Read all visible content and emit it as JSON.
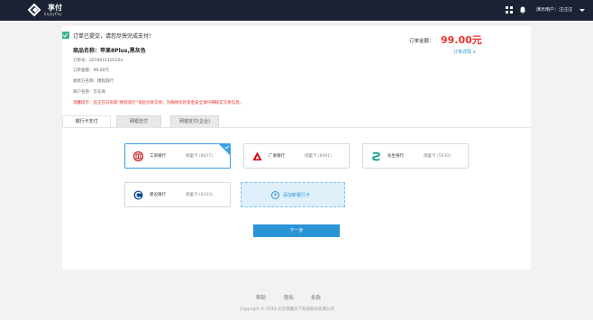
{
  "header": {
    "brand_name": "享付",
    "brand_sub": "EnjoyPay",
    "user_label": "演示用户：汪汪汪",
    "icons": [
      "grid-icon",
      "bell-icon",
      "caret-down-icon"
    ]
  },
  "order": {
    "submitted_text": "订单已提交，请您尽快完成支付！",
    "product_name": "商品名称：苹果8Plus,黑灰色",
    "order_no": "订单号：2019011105204",
    "order_amount": "订单金额：99.00元",
    "payee": "收款方名称：携程旅行",
    "merchant": "商户名称：京东商",
    "warning": "温馨提示：您正在向商家“携程旅行”发起付款交易，为确保您的资金安全请仔细核实交易信息。",
    "amount_label": "订单金额：",
    "amount_value": "99.00元",
    "detail_link": "订单详情 ∧"
  },
  "tabs": [
    {
      "label": "银行卡支付",
      "active": true
    },
    {
      "label": "网银支付",
      "active": false
    },
    {
      "label": "网银支付(企业)",
      "active": false
    }
  ],
  "cards": [
    {
      "bank": "工商银行",
      "type": "储蓄卡 (8027)",
      "icon": "icbc-icon",
      "color": "#c8161d",
      "selected": true
    },
    {
      "bank": "广发银行",
      "type": "储蓄卡 (8091)",
      "icon": "cgb-icon",
      "color": "#d7000f",
      "selected": false
    },
    {
      "bank": "民生银行",
      "type": "储蓄卡 (5930)",
      "icon": "cmbc-icon",
      "color": "#00a085",
      "selected": false
    },
    {
      "bank": "建设银行",
      "type": "储蓄卡 (8103)",
      "icon": "ccb-icon",
      "color": "#0b4a96",
      "selected": false
    }
  ],
  "add_card_label": "添加新银行卡",
  "next_button": "下一步",
  "footer": {
    "links": [
      "帮助",
      "隐私",
      "条款"
    ],
    "copyright": "Copyright © 2018 北京我趣天下科技股份有限公司"
  },
  "colors": {
    "topbar": "#1b2233",
    "accent": "#2b94d6",
    "price": "#e8332b",
    "success": "#3cb48a"
  }
}
